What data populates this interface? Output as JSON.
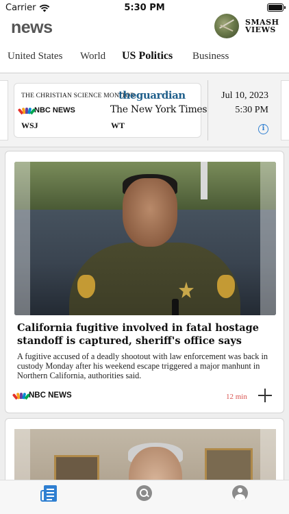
{
  "status_bar": {
    "carrier": "Carrier",
    "time": "5:30 PM"
  },
  "header": {
    "app_title": "news",
    "brand_line1": "SMASH",
    "brand_line2": "VIEWS"
  },
  "tabs": [
    {
      "label": "United States"
    },
    {
      "label": "World"
    },
    {
      "label": "US Politics",
      "active": true
    },
    {
      "label": "Business"
    }
  ],
  "sources": {
    "csm": "THE CHRISTIAN SCIENCE MONITOR",
    "guardian": "theguardian",
    "nbc": "NBC NEWS",
    "nyt": "The New York Times",
    "wsj": "WSJ",
    "wt": "WT"
  },
  "date_panel": {
    "date": "Jul 10, 2023",
    "time": "5:30 PM"
  },
  "articles": [
    {
      "headline": "California fugitive involved in fatal hostage standoff is captured, sheriff's office says",
      "summary": "A fugitive accused of a deadly shootout with law enforcement was back in custody Monday after his weekend escape triggered a major manhunt in Northern California, authorities said.",
      "source": "NBC NEWS",
      "read_time": "12 min"
    }
  ],
  "colors": {
    "accent": "#2f7fd1",
    "read_time": "#d9534f",
    "guardian": "#1f5f8b"
  },
  "tab_bar": {
    "icons": [
      "news-icon",
      "search-icon",
      "profile-icon"
    ]
  }
}
